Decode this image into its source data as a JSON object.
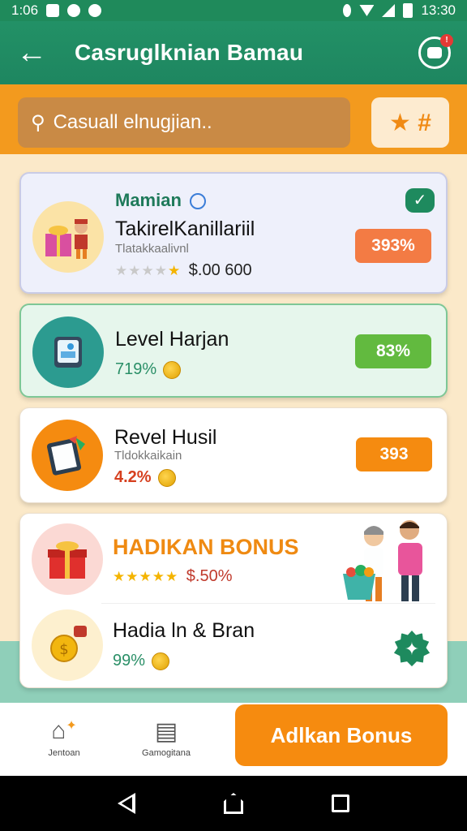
{
  "status": {
    "time_left": "1:06",
    "time_right": "13:30"
  },
  "appbar": {
    "title": "Casruglknian Bamau",
    "badge": "!"
  },
  "search": {
    "placeholder": "Casuall elnugjian..",
    "filter_label": "★ #"
  },
  "cards": [
    {
      "label": "Mamian",
      "title": "TakirelKanillariil",
      "subtitle": "Tlatakkaalivnl",
      "rating": "★★★★★",
      "amount": "$.00 600",
      "percent": "393%",
      "percent_color": "#f37b44",
      "check": "✓"
    },
    {
      "title": "Level Harjan",
      "value": "719%",
      "percent": "83%",
      "percent_color": "#62ba3f"
    },
    {
      "title": "Revel Husil",
      "subtitle": "Tldokkaikain",
      "value": "4.2%",
      "percent": "393",
      "percent_color": "#f58b10"
    }
  ],
  "bonus": {
    "title": "HADIKAN BONUS",
    "stars": "★★★★★",
    "amount": "$.50%",
    "item_title": "Hadia ln & Bran",
    "item_value": "99%"
  },
  "bottom_nav": [
    {
      "label": "Jentoan"
    },
    {
      "label": "Gamogitana"
    }
  ],
  "cta": {
    "label": "Adlkan Bonus"
  },
  "colors": {
    "primary": "#1f8a5b",
    "accent": "#f39a1e",
    "cta": "#f68b0f"
  }
}
